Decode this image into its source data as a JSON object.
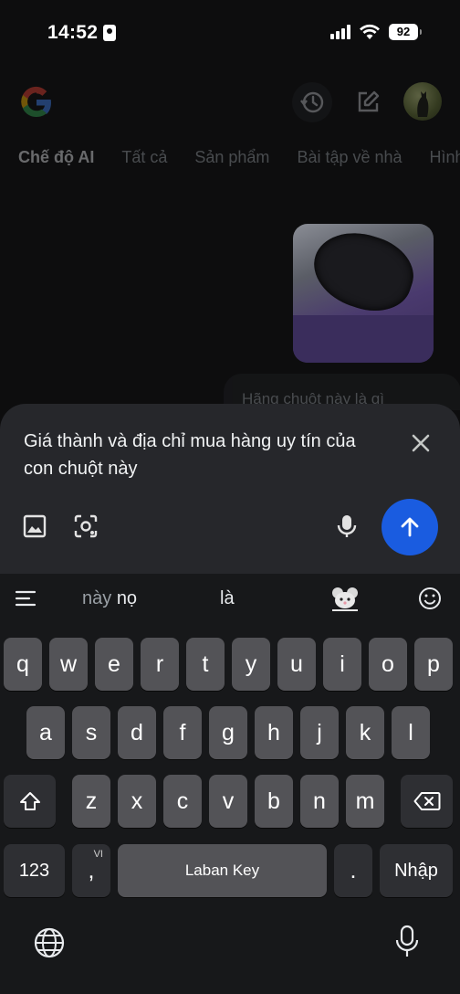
{
  "status": {
    "time": "14:52",
    "battery": "92"
  },
  "tabs": [
    "Chế độ AI",
    "Tất cả",
    "Sản phẩm",
    "Bài tập về nhà",
    "Hình"
  ],
  "chat": {
    "previous_message": "Hãng chuột này là gì"
  },
  "input": {
    "query": "Giá thành và địa chỉ mua hàng uy tín của con chuột này"
  },
  "keyboard": {
    "suggestions": {
      "first_a": "này",
      "first_b": "nọ",
      "second": "là"
    },
    "row1": [
      "q",
      "w",
      "e",
      "r",
      "t",
      "y",
      "u",
      "i",
      "o",
      "p"
    ],
    "row2": [
      "a",
      "s",
      "d",
      "f",
      "g",
      "h",
      "j",
      "k",
      "l"
    ],
    "row3": [
      "z",
      "x",
      "c",
      "v",
      "b",
      "n",
      "m"
    ],
    "numbers_key": "123",
    "comma_key": ",",
    "lang_badge": "VI",
    "space_label": "Laban Key",
    "period_key": ".",
    "enter_label": "Nhập"
  },
  "colors": {
    "send_button": "#1a5ce0",
    "panel": "#26272b",
    "background": "#0d0d0e"
  }
}
